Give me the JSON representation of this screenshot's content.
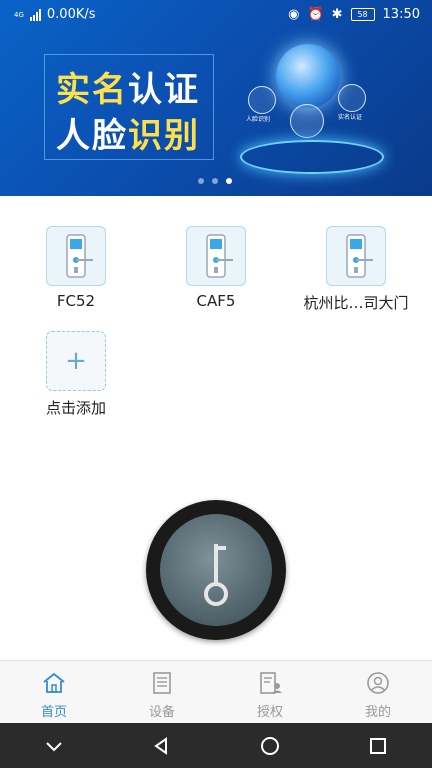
{
  "status_bar": {
    "network_type": "4G",
    "speed": "0.00K/s",
    "battery": "58",
    "time": "13:50"
  },
  "banner": {
    "title_line1_a": "实名",
    "title_line1_b": "认证",
    "title_line2_a": "人脸",
    "title_line2_b": "识别",
    "label_face": "人脸识别",
    "label_realname": "实名认证",
    "carousel_dots": 3,
    "active_dot": 3
  },
  "devices": [
    {
      "name": "FC52"
    },
    {
      "name": "CAF5"
    },
    {
      "name": "杭州比…司大门"
    }
  ],
  "add_device": {
    "label": "点击添加",
    "icon": "plus-icon"
  },
  "unlock_button": {
    "icon": "key-icon"
  },
  "tabs": [
    {
      "label": "首页",
      "icon": "home-icon",
      "active": true
    },
    {
      "label": "设备",
      "icon": "device-list-icon",
      "active": false
    },
    {
      "label": "授权",
      "icon": "authorize-icon",
      "active": false
    },
    {
      "label": "我的",
      "icon": "user-icon",
      "active": false
    }
  ],
  "colors": {
    "accent": "#2f8cd6",
    "banner_blue": "#0b4fb0",
    "title_yellow": "#ffe04a"
  }
}
